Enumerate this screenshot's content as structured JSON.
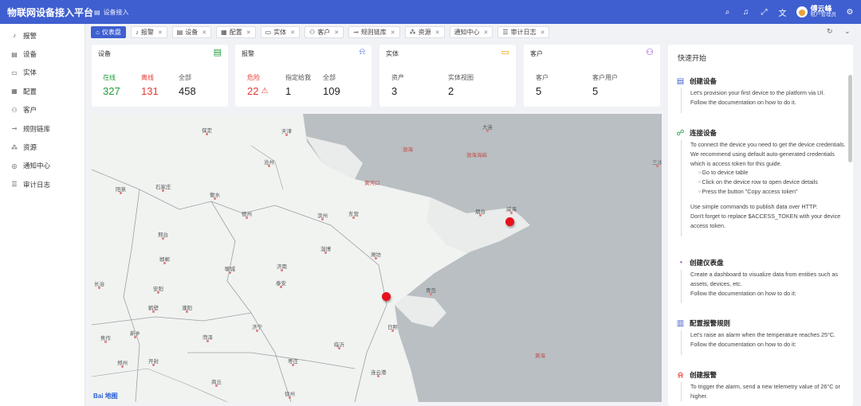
{
  "header": {
    "brand": "物联网设备接入平台",
    "breadcrumb": "设备接入",
    "user_name": "傅云峰",
    "user_role": "租户管理员"
  },
  "sidebar": {
    "items": [
      {
        "label": "报警",
        "icon": "bell-icon"
      },
      {
        "label": "设备",
        "icon": "device-icon"
      },
      {
        "label": "实体",
        "icon": "monitor-icon"
      },
      {
        "label": "配置",
        "icon": "config-icon"
      },
      {
        "label": "客户",
        "icon": "customers-icon"
      },
      {
        "label": "规则链库",
        "icon": "rule-chain-icon"
      },
      {
        "label": "资源",
        "icon": "resources-icon"
      },
      {
        "label": "通知中心",
        "icon": "notification-icon"
      },
      {
        "label": "审计日志",
        "icon": "audit-log-icon"
      }
    ]
  },
  "tabs": [
    {
      "label": "仪表盘",
      "active": true
    },
    {
      "label": "报警"
    },
    {
      "label": "设备"
    },
    {
      "label": "配置"
    },
    {
      "label": "实体"
    },
    {
      "label": "客户"
    },
    {
      "label": "规则链库"
    },
    {
      "label": "资源"
    },
    {
      "label": "通知中心"
    },
    {
      "label": "审计日志"
    }
  ],
  "cards": {
    "devices": {
      "title": "设备",
      "online_label": "在线",
      "online_value": "327",
      "offline_label": "离线",
      "offline_value": "131",
      "all_label": "全部",
      "all_value": "458"
    },
    "alarms": {
      "title": "报警",
      "critical_label": "危险",
      "critical_value": "22",
      "assigned_label": "指定给我",
      "assigned_value": "1",
      "all_label": "全部",
      "all_value": "109"
    },
    "entities": {
      "title": "实体",
      "assets_label": "资产",
      "assets_value": "3",
      "views_label": "实体视图",
      "views_value": "2"
    },
    "customers": {
      "title": "客户",
      "customers_label": "客户",
      "customers_value": "5",
      "users_label": "客户用户",
      "users_value": "5"
    }
  },
  "map": {
    "attribution": "Bai 地图",
    "cities": [
      "保定",
      "天津",
      "沧州",
      "大连",
      "衡水",
      "石家庄",
      "阳泉",
      "德州",
      "滨州",
      "东营",
      "潍坊",
      "烟台",
      "威海",
      "淄博",
      "济南",
      "聊城",
      "邢台",
      "邯郸",
      "泰安",
      "安阳",
      "长治",
      "鹤壁",
      "濮阳",
      "济宁",
      "新乡",
      "焦作",
      "菏泽",
      "临沂",
      "日照",
      "青岛",
      "开封",
      "郑州",
      "枣庄",
      "连云港",
      "商丘",
      "徐州"
    ],
    "seas": [
      "渤海",
      "渤海海峡",
      "黄河口",
      "黄海"
    ],
    "coast_label": "三沙"
  },
  "quick_start": {
    "title": "快速开始",
    "steps": [
      {
        "title": "创建设备",
        "icon": "device-icon",
        "lines": [
          "Let's provision your first device to the platform via UI.",
          "Follow the documentation on how to do it."
        ]
      },
      {
        "title": "连接设备",
        "icon": "link-icon",
        "lines": [
          "To connect the device you need to get the device credentials.",
          "We recommend using default auto-generated credentials which is access token for this guide."
        ],
        "bullets": [
          "Go to device table",
          "Click on the device row to open device details",
          "Press the button \"Copy access token\""
        ],
        "lines2": [
          "Use simple commands to publish data over HTTP.",
          "Don't forget to replace $ACCESS_TOKEN with your device access token."
        ]
      },
      {
        "title": "创建仪表盘",
        "icon": "dashboard-icon",
        "lines": [
          "Create a dashboard to visualize data from entities such as assets, devices, etc.",
          "Follow the documentation on how to do it:"
        ]
      },
      {
        "title": "配置报警规则",
        "icon": "alarm-rule-icon",
        "lines": [
          "Let's raise an alarm when the temperature reaches 25°C.",
          "Follow the documentation on how to do it:"
        ]
      },
      {
        "title": "创建报警",
        "icon": "alarm-icon",
        "lines": [
          "To trigger the alarm, send a new telemetry value of 26°C or higher."
        ]
      }
    ]
  },
  "colors": {
    "primary": "#3f5fd0",
    "online": "#1f9d3a",
    "offline": "#e53935",
    "critical": "#e53935",
    "marker": "#e8101b"
  }
}
